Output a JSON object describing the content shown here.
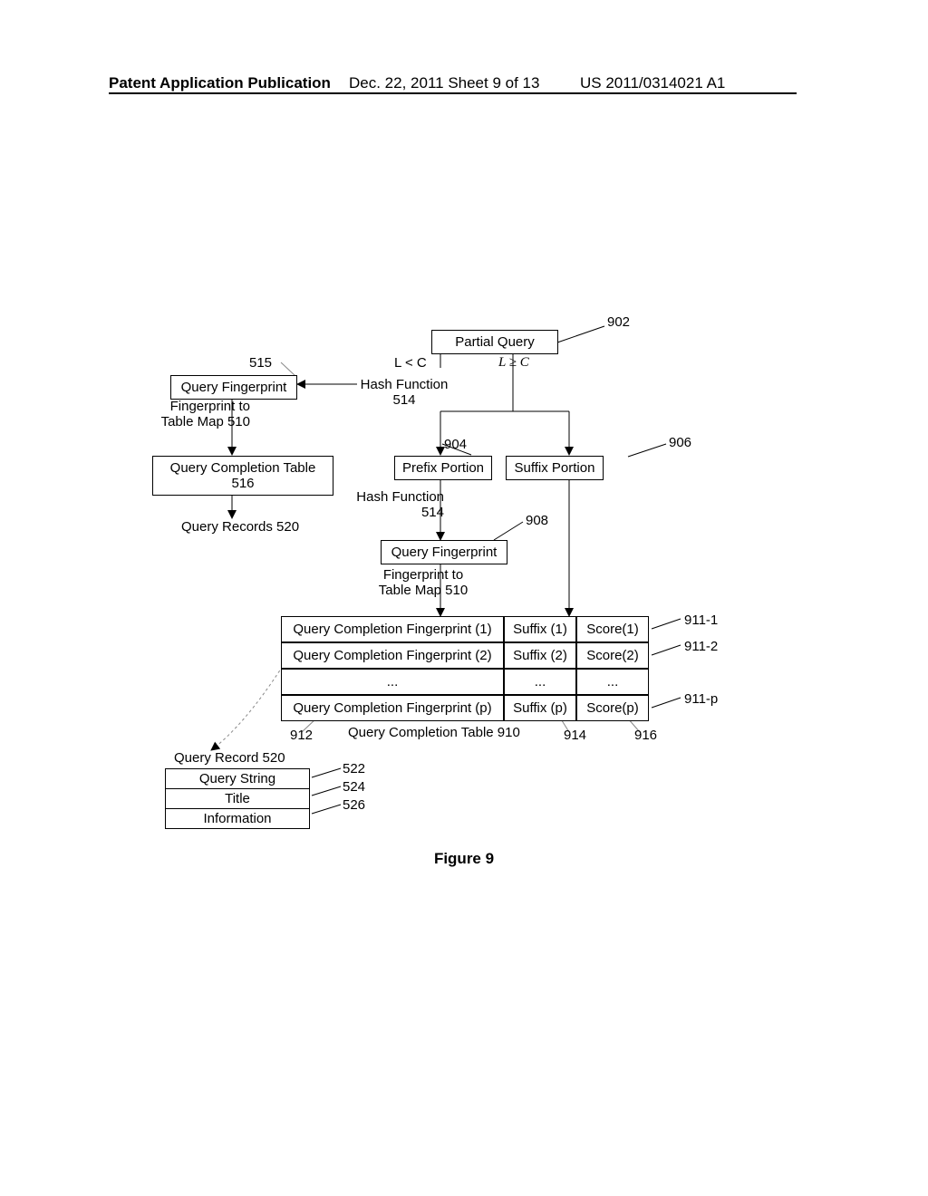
{
  "header": {
    "left": "Patent Application Publication",
    "mid": "Dec. 22, 2011  Sheet 9 of 13",
    "right": "US 2011/0314021 A1"
  },
  "partial_query": "Partial Query",
  "ref_902": "902",
  "cond_L_lt_C": "L < C",
  "cond_L_ge_C": "L ≥ C",
  "ref_515": "515",
  "query_fp_515": "Query Fingerprint",
  "hash_514": "Hash Function 514",
  "fp_to_map_510": "Fingerprint to Table Map 510",
  "qc_table_516": "Query Completion Table 516",
  "query_records_520": "Query Records 520",
  "ref_904": "904",
  "prefix_portion": "Prefix Portion",
  "suffix_portion": "Suffix Portion",
  "ref_906": "906",
  "query_fp_908": "Query Fingerprint",
  "ref_908": "908",
  "qc_fp_1": "Query Completion Fingerprint (1)",
  "qc_fp_2": "Query Completion Fingerprint (2)",
  "qc_fp_p": "Query Completion Fingerprint (p)",
  "dots": "...",
  "suffix_1": "Suffix (1)",
  "suffix_2": "Suffix (2)",
  "suffix_p": "Suffix (p)",
  "score_1": "Score(1)",
  "score_2": "Score(2)",
  "score_p": "Score(p)",
  "ref_911_1": "911-1",
  "ref_911_2": "911-2",
  "ref_911_p": "911-p",
  "ref_912": "912",
  "qc_table_910": "Query Completion Table 910",
  "ref_914": "914",
  "ref_916": "916",
  "query_record_520": "Query Record  520",
  "ref_522": "522",
  "ref_524": "524",
  "ref_526": "526",
  "query_string": "Query String",
  "title_row": "Title",
  "information_row": "Information",
  "figure_caption": "Figure 9"
}
